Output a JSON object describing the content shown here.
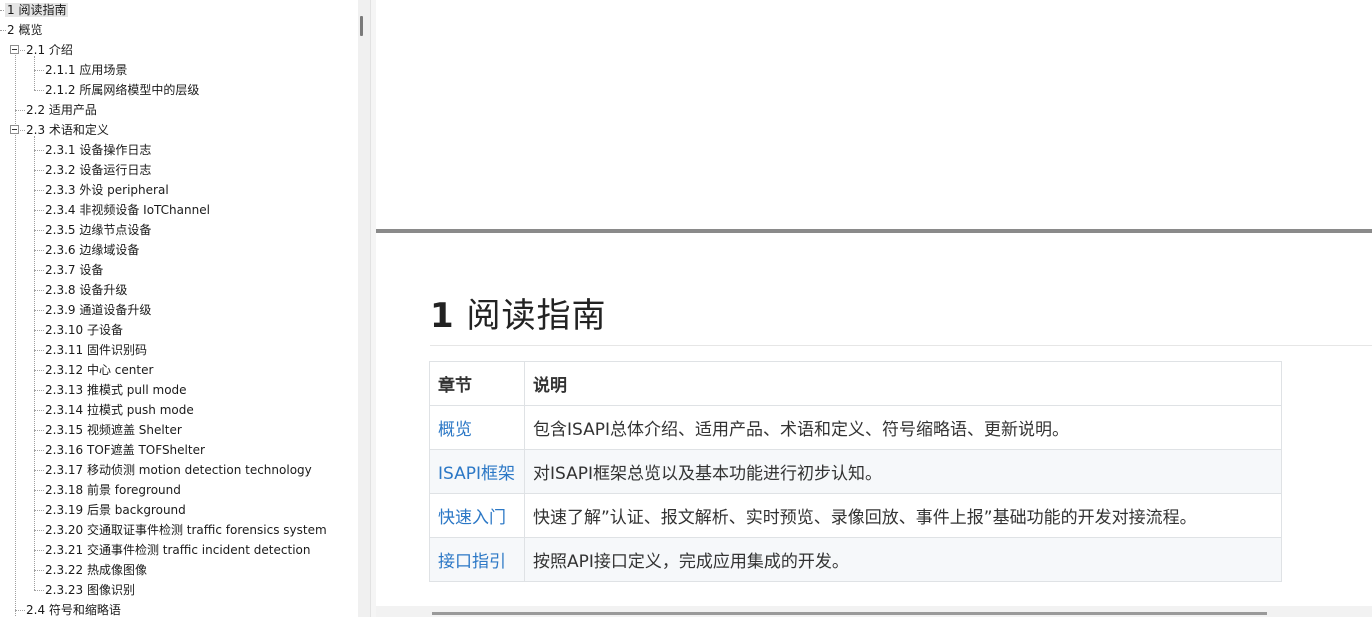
{
  "tree": {
    "items": [
      {
        "label": "1 阅读指南",
        "level": 0,
        "selected": true,
        "expander": false
      },
      {
        "label": "2 概览",
        "level": 0,
        "selected": false,
        "expander": false
      },
      {
        "label": "2.1 介绍",
        "level": 1,
        "selected": false,
        "expander": true
      },
      {
        "label": "2.1.1 应用场景",
        "level": 2,
        "selected": false,
        "expander": false
      },
      {
        "label": "2.1.2 所属网络模型中的层级",
        "level": 2,
        "selected": false,
        "expander": false
      },
      {
        "label": "2.2 适用产品",
        "level": 1,
        "selected": false,
        "expander": false
      },
      {
        "label": "2.3 术语和定义",
        "level": 1,
        "selected": false,
        "expander": true
      },
      {
        "label": "2.3.1 设备操作日志",
        "level": 2,
        "selected": false,
        "expander": false
      },
      {
        "label": "2.3.2 设备运行日志",
        "level": 2,
        "selected": false,
        "expander": false
      },
      {
        "label": "2.3.3 外设 peripheral",
        "level": 2,
        "selected": false,
        "expander": false
      },
      {
        "label": "2.3.4 非视频设备 IoTChannel",
        "level": 2,
        "selected": false,
        "expander": false
      },
      {
        "label": "2.3.5 边缘节点设备",
        "level": 2,
        "selected": false,
        "expander": false
      },
      {
        "label": "2.3.6 边缘域设备",
        "level": 2,
        "selected": false,
        "expander": false
      },
      {
        "label": "2.3.7 设备",
        "level": 2,
        "selected": false,
        "expander": false
      },
      {
        "label": "2.3.8 设备升级",
        "level": 2,
        "selected": false,
        "expander": false
      },
      {
        "label": "2.3.9 通道设备升级",
        "level": 2,
        "selected": false,
        "expander": false
      },
      {
        "label": "2.3.10 子设备",
        "level": 2,
        "selected": false,
        "expander": false
      },
      {
        "label": "2.3.11 固件识别码",
        "level": 2,
        "selected": false,
        "expander": false
      },
      {
        "label": "2.3.12 中心 center",
        "level": 2,
        "selected": false,
        "expander": false
      },
      {
        "label": "2.3.13 推模式 pull mode",
        "level": 2,
        "selected": false,
        "expander": false
      },
      {
        "label": "2.3.14 拉模式 push mode",
        "level": 2,
        "selected": false,
        "expander": false
      },
      {
        "label": "2.3.15 视频遮盖 Shelter",
        "level": 2,
        "selected": false,
        "expander": false
      },
      {
        "label": "2.3.16 TOF遮盖 TOFShelter",
        "level": 2,
        "selected": false,
        "expander": false
      },
      {
        "label": "2.3.17 移动侦测 motion detection technology",
        "level": 2,
        "selected": false,
        "expander": false
      },
      {
        "label": "2.3.18 前景 foreground",
        "level": 2,
        "selected": false,
        "expander": false
      },
      {
        "label": "2.3.19 后景 background",
        "level": 2,
        "selected": false,
        "expander": false
      },
      {
        "label": "2.3.20 交通取证事件检测 traffic forensics system",
        "level": 2,
        "selected": false,
        "expander": false
      },
      {
        "label": "2.3.21 交通事件检测 traffic incident detection",
        "level": 2,
        "selected": false,
        "expander": false
      },
      {
        "label": "2.3.22 热成像图像",
        "level": 2,
        "selected": false,
        "expander": false
      },
      {
        "label": "2.3.23 图像识别",
        "level": 2,
        "selected": false,
        "expander": false
      },
      {
        "label": "2.4 符号和缩略语",
        "level": 1,
        "selected": false,
        "expander": false
      }
    ]
  },
  "document": {
    "heading_number": "1",
    "heading_text": "阅读指南",
    "table": {
      "headers": [
        "章节",
        "说明"
      ],
      "rows": [
        {
          "chapter": "概览",
          "description": "包含ISAPI总体介绍、适用产品、术语和定义、符号缩略语、更新说明。"
        },
        {
          "chapter": "ISAPI框架",
          "description": "对ISAPI框架总览以及基本功能进行初步认知。"
        },
        {
          "chapter": "快速入门",
          "description": "快速了解”认证、报文解析、实时预览、录像回放、事件上报”基础功能的开发对接流程。"
        },
        {
          "chapter": "接口指引",
          "description": "按照API接口定义，完成应用集成的开发。"
        }
      ]
    }
  },
  "colors": {
    "link": "#2c78c6",
    "selected_bg": "#e5e5e5",
    "page_separator": "#8a8a8a",
    "table_border": "#dfe2e5",
    "alt_row_bg": "#f6f8fa"
  }
}
